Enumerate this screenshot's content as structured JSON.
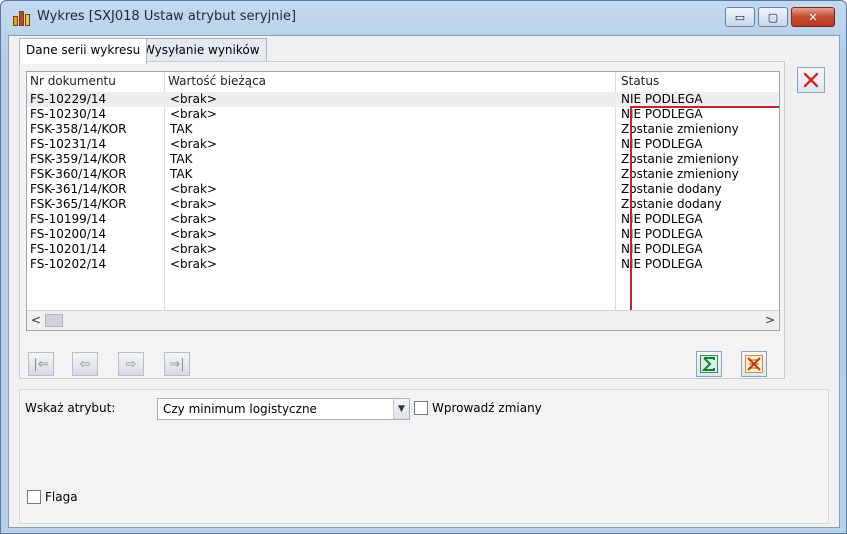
{
  "window": {
    "title": "Wykres [SXJ018 Ustaw atrybut seryjnie]",
    "minimize_glyph": "▭",
    "maximize_glyph": "▢",
    "close_glyph": "✕"
  },
  "tabs": [
    {
      "label": "Dane serii wykresu",
      "active": true
    },
    {
      "label": "Wysyłanie wyników",
      "active": false
    }
  ],
  "grid": {
    "columns": [
      "Nr dokumentu",
      "Wartość bieżąca",
      "Status"
    ],
    "rows": [
      [
        "FS-10229/14",
        "<brak>",
        "NIE PODLEGA"
      ],
      [
        "FS-10230/14",
        "<brak>",
        "NIE PODLEGA"
      ],
      [
        "FSK-358/14/KOR",
        "TAK",
        "Zostanie zmieniony"
      ],
      [
        "FS-10231/14",
        "<brak>",
        "NIE PODLEGA"
      ],
      [
        "FSK-359/14/KOR",
        "TAK",
        "Zostanie zmieniony"
      ],
      [
        "FSK-360/14/KOR",
        "TAK",
        "Zostanie zmieniony"
      ],
      [
        "FSK-361/14/KOR",
        "<brak>",
        "Zostanie dodany"
      ],
      [
        "FSK-365/14/KOR",
        "<brak>",
        "Zostanie dodany"
      ],
      [
        "FS-10199/14",
        "<brak>",
        "NIE PODLEGA"
      ],
      [
        "FS-10200/14",
        "<brak>",
        "NIE PODLEGA"
      ],
      [
        "FS-10201/14",
        "<brak>",
        "NIE PODLEGA"
      ],
      [
        "FS-10202/14",
        "<brak>",
        "NIE PODLEGA"
      ]
    ],
    "selected_row": 0,
    "highlight_color": "#c0252a"
  },
  "scrollbar": {
    "left_arrow": "<",
    "right_arrow": ">"
  },
  "navigation": {
    "first_glyph": "|⇐",
    "prev_glyph": "⇦",
    "next_glyph": "⇨",
    "last_glyph": "⇒|"
  },
  "icons": {
    "delete": "close-icon",
    "sum": "sigma-icon",
    "clear": "clear-filter-icon"
  },
  "form": {
    "attribute_label": "Wskaż atrybut:",
    "attribute_value": "Czy minimum logistyczne",
    "apply_changes_label": "Wprowadź zmiany",
    "apply_changes_checked": false,
    "flag_label": "Flaga",
    "flag_checked": false
  }
}
